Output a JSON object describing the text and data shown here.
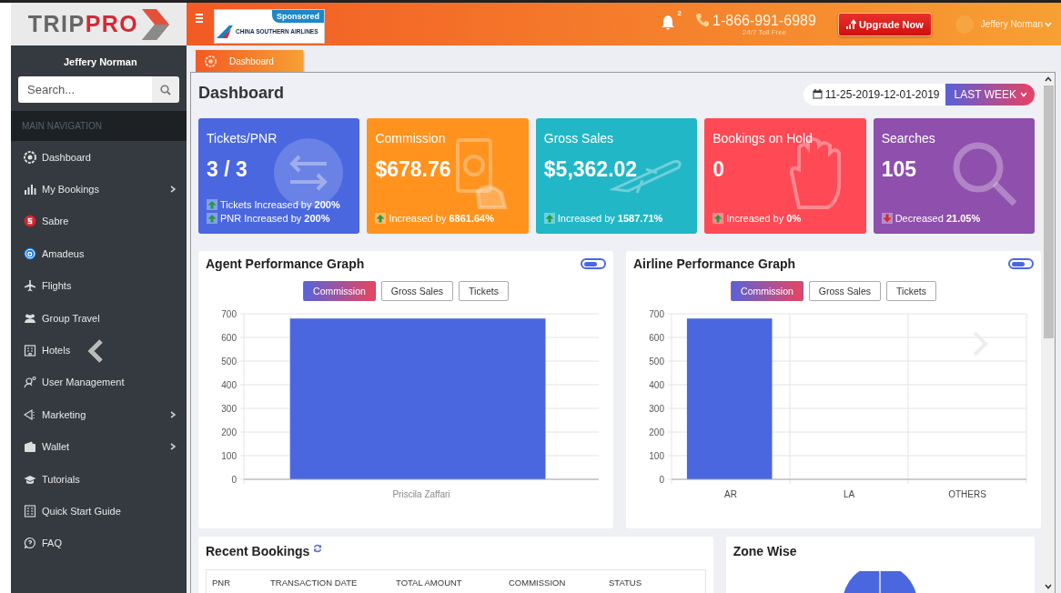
{
  "header": {
    "logo": {
      "text": "TRIP",
      "accent": "PRO"
    },
    "ad": {
      "badge": "Sponsored",
      "text": "CHINA SOUTHERN AIRLINES"
    },
    "notifications": "2",
    "phone": "1-866-991-6989",
    "phone_note": "24/7 Toll Free",
    "upgrade_button": "Upgrade Now",
    "user": "Jeffery Norman"
  },
  "sidebar": {
    "user": "Jeffery Norman",
    "search": {
      "placeholder": "Search..."
    },
    "heading": "MAIN NAVIGATION",
    "items": [
      {
        "label": "Dashboard",
        "expandable": false
      },
      {
        "label": "My Bookings",
        "expandable": true
      },
      {
        "label": "Sabre",
        "expandable": false
      },
      {
        "label": "Amadeus",
        "expandable": false
      },
      {
        "label": "Flights",
        "expandable": false
      },
      {
        "label": "Group Travel",
        "expandable": false
      },
      {
        "label": "Hotels",
        "expandable": false
      },
      {
        "label": "User Management",
        "expandable": false
      },
      {
        "label": "Marketing",
        "expandable": true
      },
      {
        "label": "Wallet",
        "expandable": true
      },
      {
        "label": "Tutorials",
        "expandable": false
      },
      {
        "label": "Quick Start Guide",
        "expandable": false
      },
      {
        "label": "FAQ",
        "expandable": false
      }
    ]
  },
  "tab": "Dashboard",
  "page": {
    "title": "Dashboard",
    "date_range": "11-25-2019-12-01-2019",
    "period": "LAST WEEK"
  },
  "stats": [
    {
      "title": "Tickets/PNR",
      "value": "3 / 3",
      "color": "#4a67e0",
      "changes": [
        {
          "kind": "up",
          "text": "Tickets Increased by **200%**"
        },
        {
          "kind": "up",
          "text": "PNR Increased by **200%**"
        }
      ]
    },
    {
      "title": "Commission",
      "value": "$678.76",
      "color": "#ff931e",
      "changes": [
        {
          "kind": "up",
          "text": "Increased by **6861.64%**"
        }
      ]
    },
    {
      "title": "Gross Sales",
      "value": "$5,362.02",
      "color": "#22b7c6",
      "changes": [
        {
          "kind": "up",
          "text": "Increased by **1587.71%**"
        }
      ]
    },
    {
      "title": "Bookings on Hold",
      "value": "0",
      "color": "#ff4a55",
      "changes": [
        {
          "kind": "up",
          "text": "Increased by **0%**"
        }
      ]
    },
    {
      "title": "Searches",
      "value": "105",
      "color": "#8e4fad",
      "changes": [
        {
          "kind": "down",
          "text": "Decreased **21.05%**"
        }
      ]
    }
  ],
  "graphs": [
    {
      "title": "Agent Performance Graph",
      "toggle_on": false,
      "buttons": [
        {
          "label": "Commission",
          "selected": true
        },
        {
          "label": "Gross Sales",
          "selected": false
        },
        {
          "label": "Tickets",
          "selected": false
        }
      ],
      "chart_data": {
        "type": "bar",
        "categories": [
          "Priscila Zaffari"
        ],
        "values": [
          680
        ],
        "ylim": [
          0,
          700
        ],
        "yticks": [
          0,
          100,
          200,
          300,
          400,
          500,
          600,
          700
        ],
        "grid": true
      }
    },
    {
      "title": "Airline Performance Graph",
      "toggle_on": false,
      "buttons": [
        {
          "label": "Commission",
          "selected": true
        },
        {
          "label": "Gross Sales",
          "selected": false
        },
        {
          "label": "Tickets",
          "selected": false
        }
      ],
      "chart_data": {
        "type": "bar",
        "categories": [
          "AR",
          "LA",
          "OTHERS"
        ],
        "values": [
          680,
          0,
          0
        ],
        "ylim": [
          0,
          700
        ],
        "yticks": [
          0,
          100,
          200,
          300,
          400,
          500,
          600,
          700
        ],
        "grid": true
      }
    }
  ],
  "recent_bookings": {
    "title": "Recent Bookings",
    "columns": [
      "PNR",
      "TRANSACTION DATE",
      "TOTAL AMOUNT",
      "COMMISSION",
      "STATUS"
    ]
  },
  "zone_wise": {
    "title": "Zone Wise"
  }
}
